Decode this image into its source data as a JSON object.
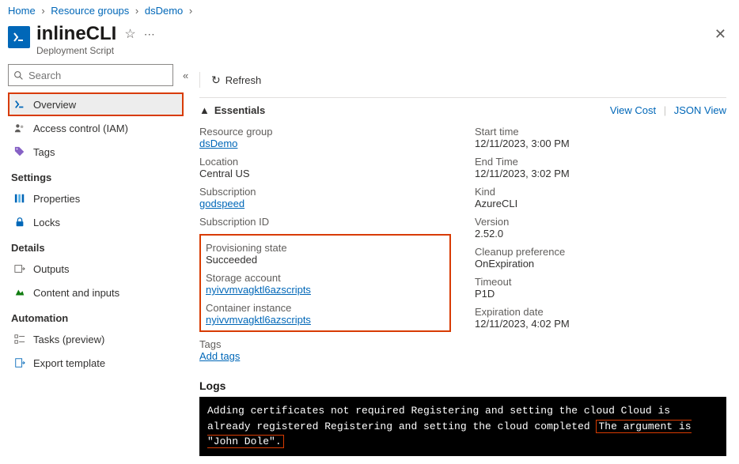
{
  "breadcrumb": {
    "home": "Home",
    "rg": "Resource groups",
    "name": "dsDemo"
  },
  "header": {
    "title": "inlineCLI",
    "subtitle": "Deployment Script"
  },
  "search": {
    "placeholder": "Search"
  },
  "nav": {
    "overview": "Overview",
    "iam": "Access control (IAM)",
    "tags": "Tags",
    "settings_h": "Settings",
    "properties": "Properties",
    "locks": "Locks",
    "details_h": "Details",
    "outputs": "Outputs",
    "content": "Content and inputs",
    "automation_h": "Automation",
    "tasks": "Tasks (preview)",
    "export": "Export template"
  },
  "toolbar": {
    "refresh": "Refresh"
  },
  "essentials": {
    "header": "Essentials",
    "viewcost": "View Cost",
    "jsonview": "JSON View",
    "left": {
      "rg_l": "Resource group",
      "rg_v": "dsDemo",
      "loc_l": "Location",
      "loc_v": "Central US",
      "sub_l": "Subscription",
      "sub_v": "godspeed",
      "subid_l": "Subscription ID",
      "prov_l": "Provisioning state",
      "prov_v": "Succeeded",
      "stg_l": "Storage account",
      "stg_v": "nyivvmvagktl6azscripts",
      "ci_l": "Container instance",
      "ci_v": "nyivvmvagktl6azscripts",
      "tags_l": "Tags",
      "tags_v": "Add tags"
    },
    "right": {
      "start_l": "Start time",
      "start_v": "12/11/2023, 3:00 PM",
      "end_l": "End Time",
      "end_v": "12/11/2023, 3:02 PM",
      "kind_l": "Kind",
      "kind_v": "AzureCLI",
      "ver_l": "Version",
      "ver_v": "2.52.0",
      "clean_l": "Cleanup preference",
      "clean_v": "OnExpiration",
      "to_l": "Timeout",
      "to_v": "P1D",
      "exp_l": "Expiration date",
      "exp_v": "12/11/2023, 4:02 PM"
    }
  },
  "logs": {
    "header": "Logs",
    "pre": "Adding certificates not required Registering and setting the cloud Cloud is already registered Registering and setting the cloud completed ",
    "hl": "The argument is \"John Dole\"."
  }
}
